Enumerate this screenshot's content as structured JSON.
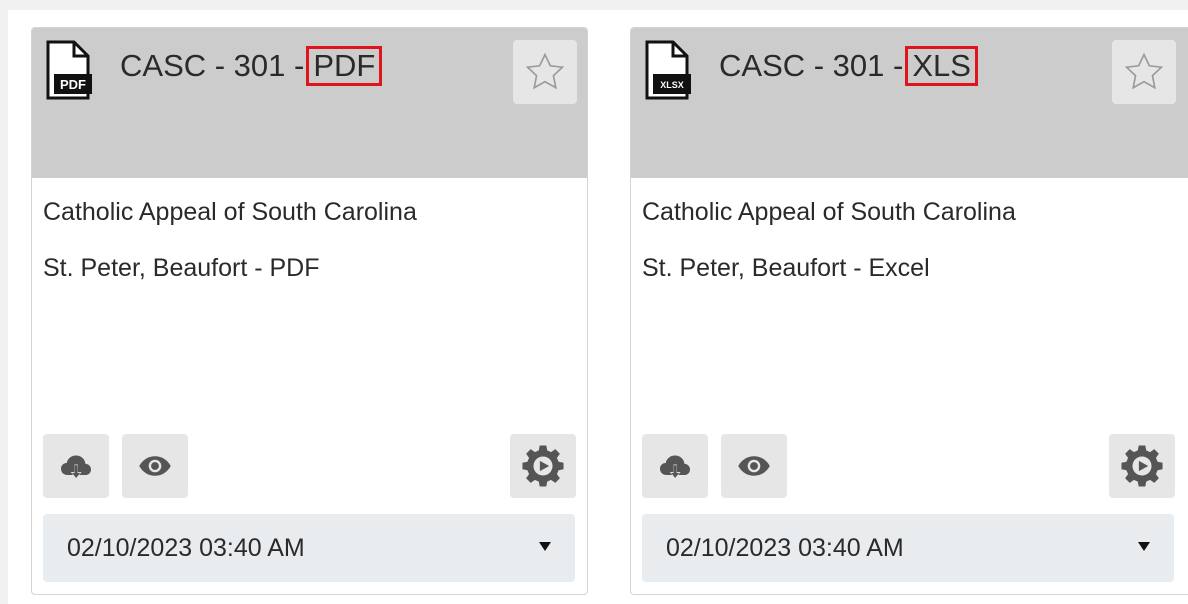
{
  "cards": [
    {
      "icon": "pdf-file-icon",
      "icon_text": "PDF",
      "title_prefix": "CASC - 301 -",
      "title_format": "PDF",
      "favorite_icon": "star-outline-icon",
      "line1": "Catholic Appeal of South Carolina",
      "line2": "St. Peter, Beaufort - PDF",
      "download_icon": "cloud-download-icon",
      "view_icon": "eye-icon",
      "settings_icon": "gear-icon",
      "date_value": "02/10/2023 03:40 AM"
    },
    {
      "icon": "xlsx-file-icon",
      "icon_text": "XLSX",
      "title_prefix": "CASC - 301 -",
      "title_format": "XLS",
      "favorite_icon": "star-outline-icon",
      "line1": "Catholic Appeal of South Carolina",
      "line2": "St. Peter, Beaufort - Excel",
      "download_icon": "cloud-download-icon",
      "view_icon": "eye-icon",
      "settings_icon": "gear-icon",
      "date_value": "02/10/2023 03:40 AM"
    }
  ],
  "colors": {
    "header_bg": "#cccccc",
    "button_bg": "#e6e6e6",
    "select_bg": "#e9ecef",
    "highlight_border": "#e0141c",
    "text": "#2a2a2a"
  }
}
